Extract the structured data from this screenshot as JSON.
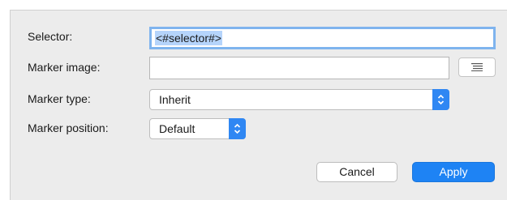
{
  "form": {
    "selector_label": "Selector:",
    "selector_value": "<#selector#>",
    "marker_image_label": "Marker image:",
    "marker_image_value": "",
    "marker_type_label": "Marker type:",
    "marker_type_value": "Inherit",
    "marker_position_label": "Marker position:",
    "marker_position_value": "Default"
  },
  "buttons": {
    "cancel_label": "Cancel",
    "apply_label": "Apply"
  },
  "icons": {
    "browse": "list-icon",
    "popup_arrows": "up-down-chevron-icon"
  },
  "colors": {
    "accent": "#1e83f4",
    "focus_ring": "#7fb4ee",
    "selection": "#b5d4fb",
    "dialog_bg": "#ececec"
  }
}
